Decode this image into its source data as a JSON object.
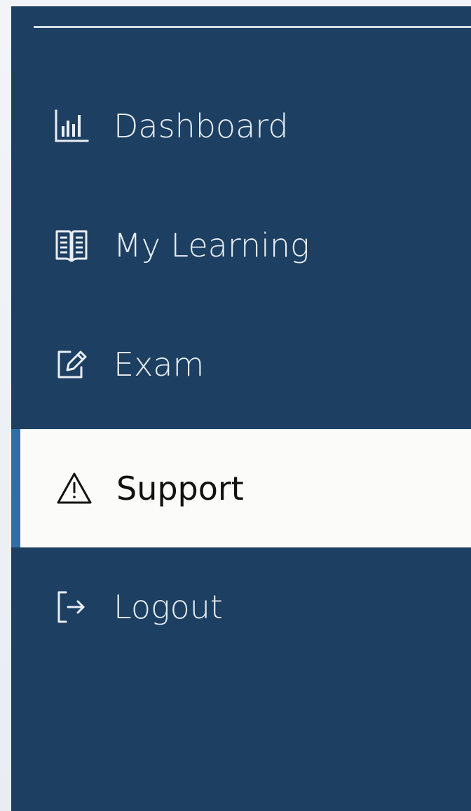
{
  "sidebar": {
    "items": [
      {
        "label": "Dashboard",
        "icon": "bar-chart-icon",
        "active": false
      },
      {
        "label": "My Learning",
        "icon": "open-book-icon",
        "active": false
      },
      {
        "label": "Exam",
        "icon": "edit-square-icon",
        "active": false
      },
      {
        "label": "Support",
        "icon": "warning-triangle-icon",
        "active": true
      },
      {
        "label": "Logout",
        "icon": "logout-icon",
        "active": false
      }
    ]
  },
  "colors": {
    "sidebar_background": "#1c3f62",
    "active_background": "#fbfbfa",
    "active_indicator": "#2f6fa8",
    "text_inactive": "#e9eef4",
    "text_active": "#111111"
  }
}
